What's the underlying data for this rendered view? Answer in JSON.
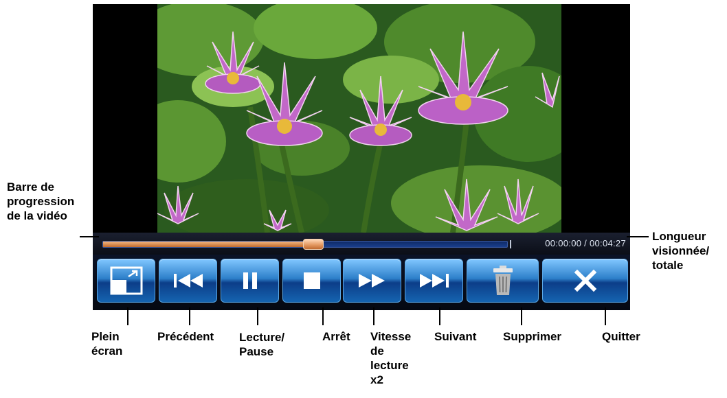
{
  "player": {
    "time_display": "00:00:00 / 00:04:27",
    "progress_fraction": 0.52
  },
  "toolbar": {
    "buttons": [
      {
        "name": "fullscreen",
        "icon": "fullscreen-icon"
      },
      {
        "name": "previous",
        "icon": "skip-back-icon"
      },
      {
        "name": "play-pause",
        "icon": "pause-icon"
      },
      {
        "name": "stop",
        "icon": "stop-icon"
      },
      {
        "name": "fast-forward",
        "icon": "fast-forward-icon"
      },
      {
        "name": "next",
        "icon": "skip-forward-icon"
      },
      {
        "name": "delete",
        "icon": "trash-icon"
      },
      {
        "name": "quit",
        "icon": "close-icon"
      }
    ]
  },
  "labels": {
    "progress": "Barre de\nprogression\nde la vidéo",
    "length": "Longueur\nvisionnée/\ntotale",
    "fullscreen": "Plein\nécran",
    "previous": "Précédent",
    "play_pause": "Lecture/\nPause",
    "stop": "Arrêt",
    "speed": "Vitesse\nde\nlecture\nx2",
    "next": "Suivant",
    "delete": "Supprimer",
    "quit": "Quitter"
  },
  "colors": {
    "button_blue": "#2d7fc9",
    "progress_orange": "#e49a63",
    "track_blue": "#1a3f8d"
  }
}
